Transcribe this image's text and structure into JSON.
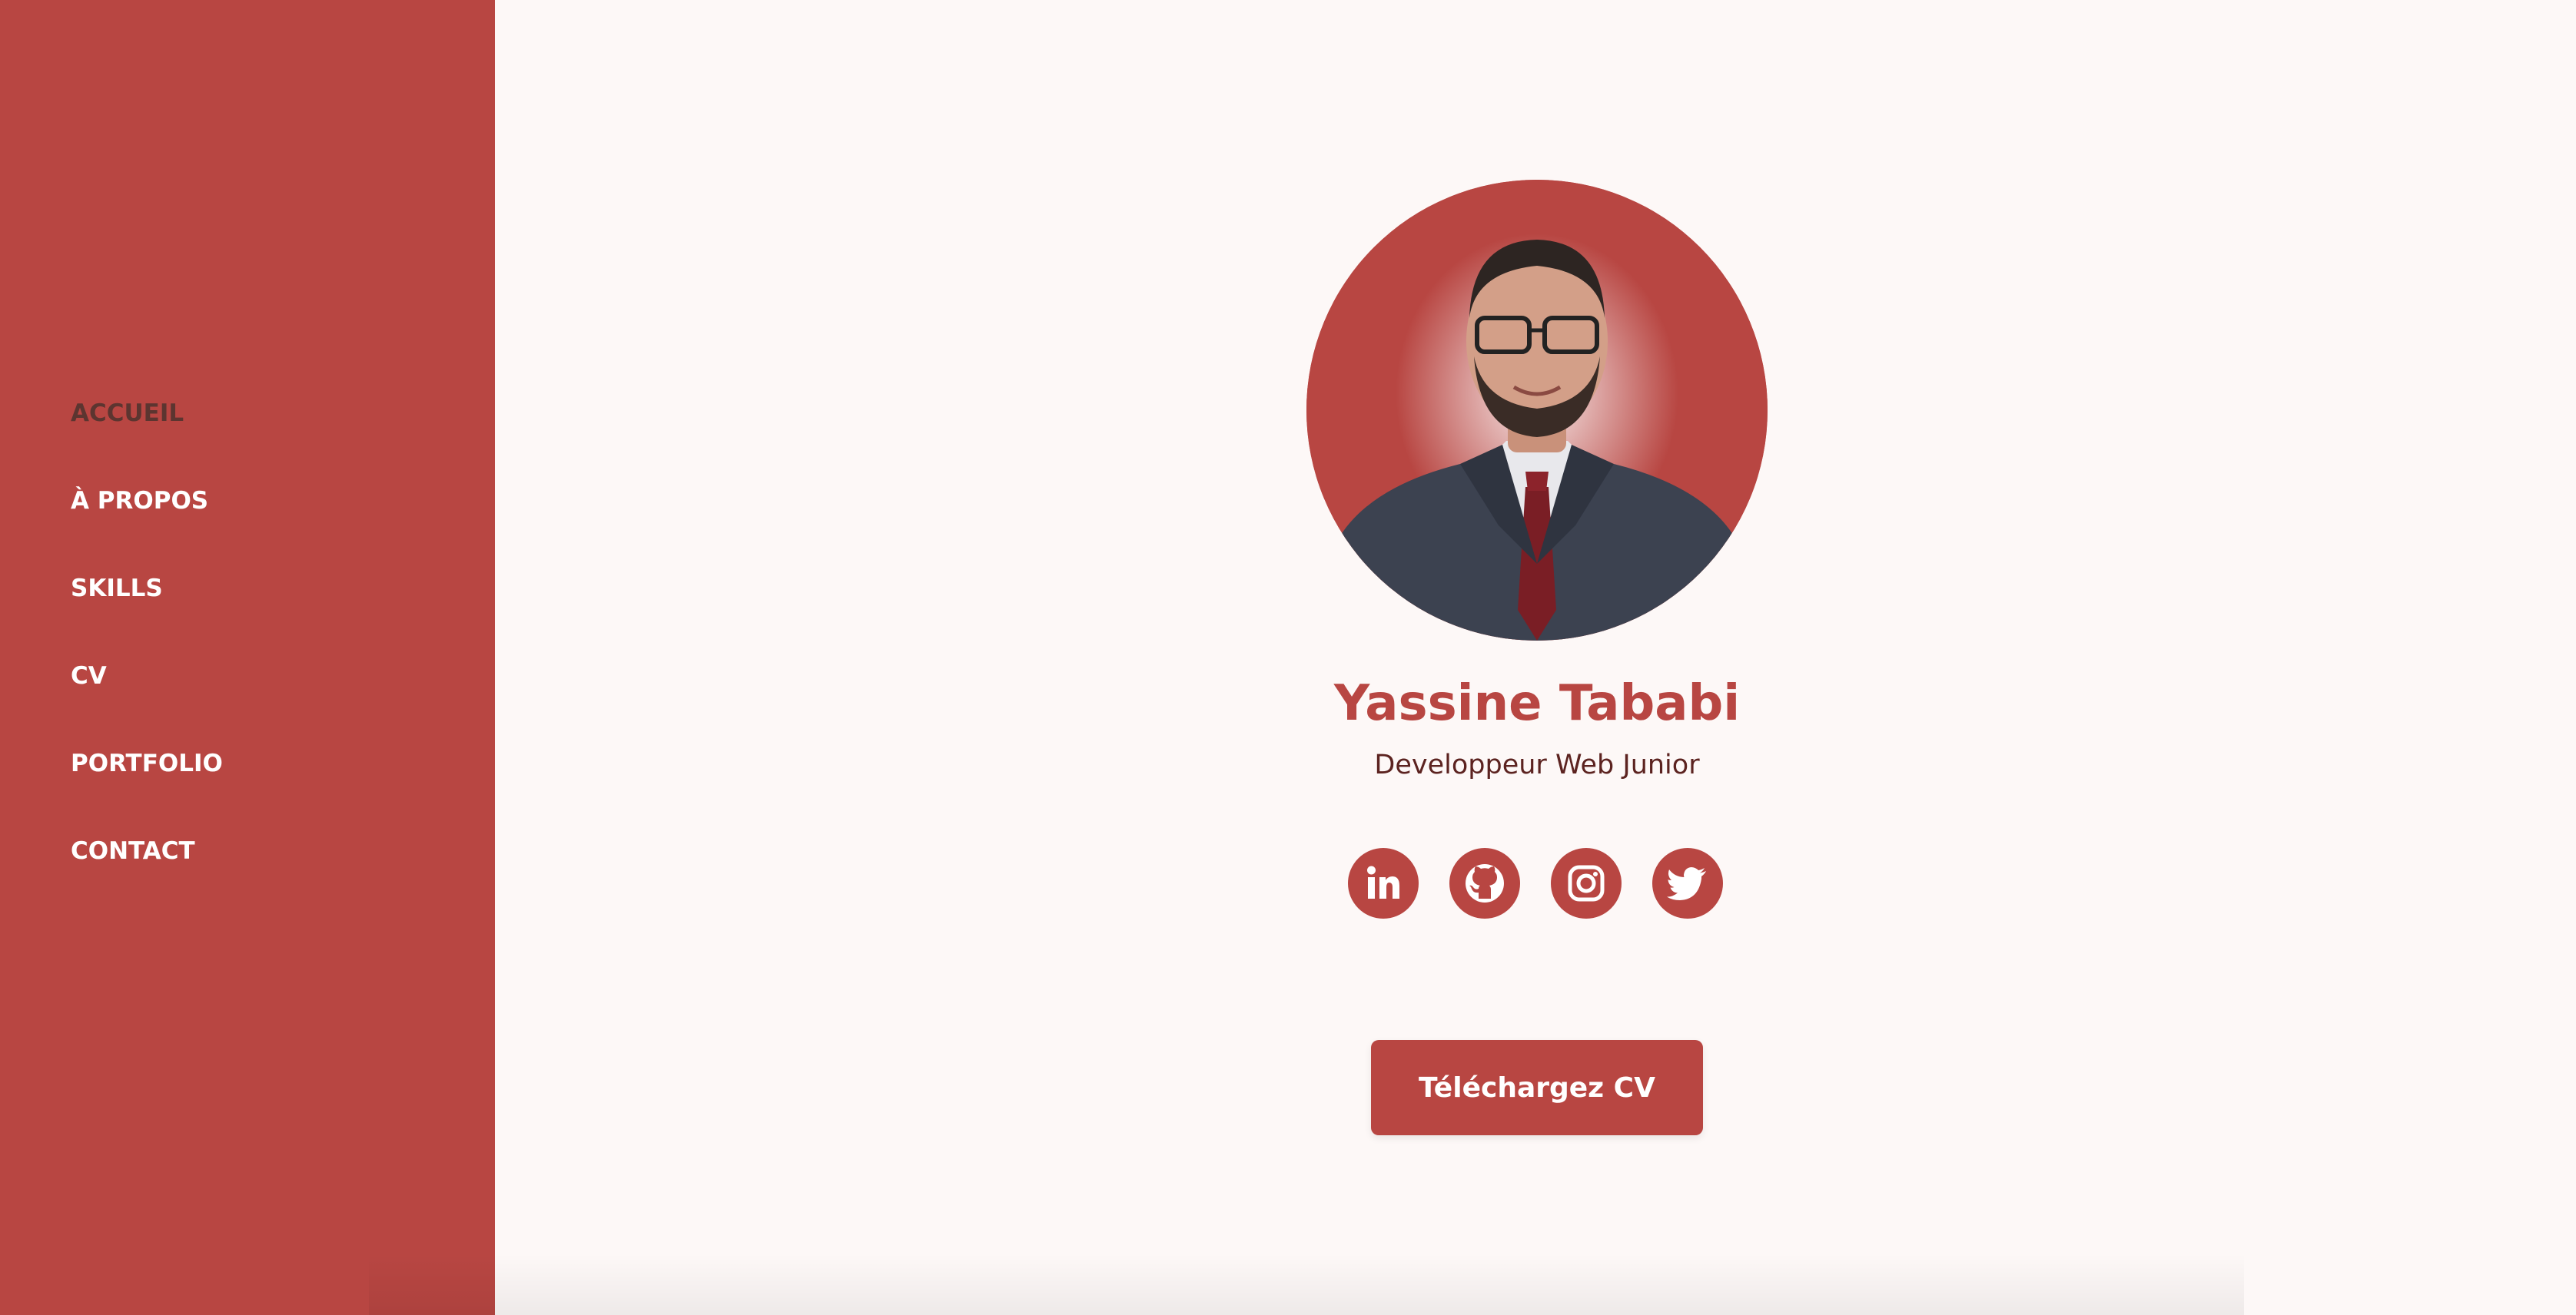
{
  "theme": {
    "accent": "#b84642",
    "background": "#fdf8f7",
    "active_nav_color": "#5c3530",
    "subtitle_color": "#5c2320"
  },
  "sidebar": {
    "items": [
      {
        "label": "ACCUEIL",
        "active": true
      },
      {
        "label": "À PROPOS",
        "active": false
      },
      {
        "label": "SKILLS",
        "active": false
      },
      {
        "label": "CV",
        "active": false
      },
      {
        "label": "PORTFOLIO",
        "active": false
      },
      {
        "label": "CONTACT",
        "active": false
      }
    ]
  },
  "profile": {
    "name": "Yassine Tababi",
    "title": "Developpeur Web Junior",
    "photo_icon": "profile-photo"
  },
  "socials": [
    {
      "name": "linkedin",
      "icon": "linkedin-icon"
    },
    {
      "name": "github",
      "icon": "github-icon"
    },
    {
      "name": "instagram",
      "icon": "instagram-icon"
    },
    {
      "name": "twitter",
      "icon": "twitter-icon"
    }
  ],
  "cta": {
    "download_label": "Téléchargez CV"
  }
}
